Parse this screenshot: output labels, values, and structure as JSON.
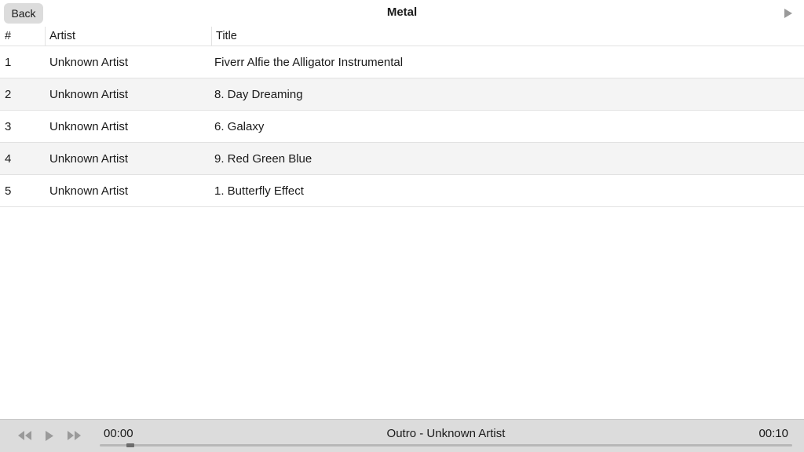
{
  "header": {
    "back_label": "Back",
    "title": "Metal",
    "play_icon": "play-icon"
  },
  "table": {
    "columns": [
      "#",
      "Artist",
      "Title"
    ],
    "rows": [
      {
        "num": "1",
        "artist": "Unknown Artist",
        "title": "Fiverr Alfie the Alligator Instrumental"
      },
      {
        "num": "2",
        "artist": "Unknown Artist",
        "title": "8. Day Dreaming"
      },
      {
        "num": "3",
        "artist": "Unknown Artist",
        "title": "6. Galaxy"
      },
      {
        "num": "4",
        "artist": "Unknown Artist",
        "title": "9. Red Green Blue"
      },
      {
        "num": "5",
        "artist": "Unknown Artist",
        "title": "1. Butterfly Effect"
      }
    ]
  },
  "player": {
    "current_time": "00:00",
    "duration": "00:10",
    "now_playing": "Outro - Unknown Artist",
    "progress": 0.0,
    "icons": [
      "rewind-icon",
      "play-icon",
      "fast-forward-icon"
    ]
  },
  "colors": {
    "row_alt": "#f4f4f4",
    "player_bg": "#dcdcdc",
    "button_bg": "#dcdcdc",
    "icon_gray": "#9a9a9a"
  }
}
